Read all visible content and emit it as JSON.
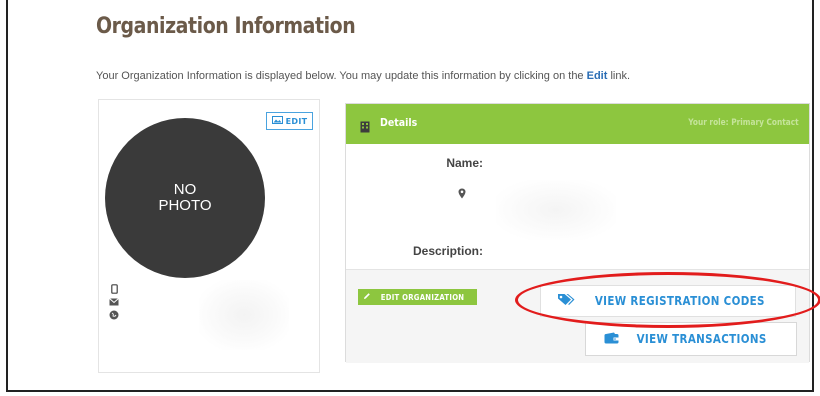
{
  "page": {
    "title": "Organization Information",
    "intro_before": "Your Organization Information is displayed below. You may update this information by clicking on the ",
    "intro_link": "Edit",
    "intro_after": " link."
  },
  "photo_card": {
    "placeholder_line1": "NO",
    "placeholder_line2": "PHOTO",
    "edit_label": "EDIT",
    "contact_icons": [
      "mobile-icon",
      "envelope-icon",
      "globe-icon"
    ]
  },
  "details_card": {
    "header_title": "Details",
    "role_text": "Your role: Primary Contact",
    "name_label": "Name:",
    "description_label": "Description:",
    "edit_org_label": "EDIT ORGANIZATION",
    "view_codes_label": "VIEW REGISTRATION CODES",
    "view_transactions_label": "VIEW TRANSACTIONS"
  },
  "colors": {
    "accent_green": "#8dc63f",
    "link_blue": "#2a8fd5",
    "title_brown": "#6b5a49",
    "annotation_red": "#e21c1c"
  }
}
